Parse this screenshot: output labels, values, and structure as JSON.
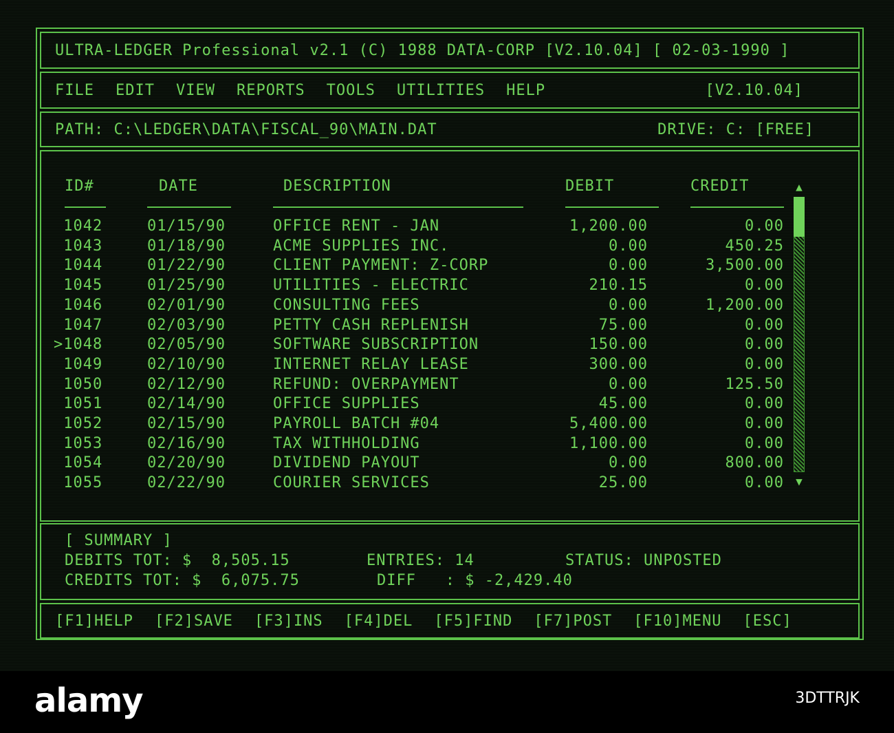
{
  "app": {
    "title": "ULTRA-LEDGER Professional v2.1 (C) 1988 DATA-CORP [V2.10.04] [ 02-03-1990 ]"
  },
  "menu": {
    "items": [
      "FILE",
      "EDIT",
      "VIEW",
      "REPORTS",
      "TOOLS",
      "UTILITIES",
      "HELP"
    ],
    "version": "[V2.10.04]"
  },
  "path_bar": {
    "path": "PATH: C:\\LEDGER\\DATA\\FISCAL_90\\MAIN.DAT",
    "drive": "DRIVE: C: [FREE]"
  },
  "table": {
    "headers": {
      "id": "ID#",
      "date": "DATE",
      "description": "DESCRIPTION",
      "debit": "DEBIT",
      "credit": "CREDIT"
    },
    "rows": [
      {
        "id": " 1042",
        "date": "01/15/90",
        "description": "OFFICE RENT - JAN",
        "debit": "1,200.00",
        "credit": "0.00"
      },
      {
        "id": " 1043",
        "date": "01/18/90",
        "description": "ACME SUPPLIES INC.",
        "debit": "0.00",
        "credit": "450.25"
      },
      {
        "id": " 1044",
        "date": "01/22/90",
        "description": "CLIENT PAYMENT: Z-CORP",
        "debit": "0.00",
        "credit": "3,500.00"
      },
      {
        "id": " 1045",
        "date": "01/25/90",
        "description": "UTILITIES - ELECTRIC",
        "debit": "210.15",
        "credit": "0.00"
      },
      {
        "id": " 1046",
        "date": "02/01/90",
        "description": "CONSULTING FEES",
        "debit": "0.00",
        "credit": "1,200.00"
      },
      {
        "id": " 1047",
        "date": "02/03/90",
        "description": "PETTY CASH REPLENISH",
        "debit": "75.00",
        "credit": "0.00"
      },
      {
        "id": ">1048",
        "date": "02/05/90",
        "description": "SOFTWARE SUBSCRIPTION",
        "debit": "150.00",
        "credit": "0.00"
      },
      {
        "id": " 1049",
        "date": "02/10/90",
        "description": "INTERNET RELAY LEASE",
        "debit": "300.00",
        "credit": "0.00"
      },
      {
        "id": " 1050",
        "date": "02/12/90",
        "description": "REFUND: OVERPAYMENT",
        "debit": "0.00",
        "credit": "125.50"
      },
      {
        "id": " 1051",
        "date": "02/14/90",
        "description": "OFFICE SUPPLIES",
        "debit": "45.00",
        "credit": "0.00"
      },
      {
        "id": " 1052",
        "date": "02/15/90",
        "description": "PAYROLL BATCH #04",
        "debit": "5,400.00",
        "credit": "0.00"
      },
      {
        "id": " 1053",
        "date": "02/16/90",
        "description": "TAX WITHHOLDING",
        "debit": "1,100.00",
        "credit": "0.00"
      },
      {
        "id": " 1054",
        "date": "02/20/90",
        "description": "DIVIDEND PAYOUT",
        "debit": "0.00",
        "credit": "800.00"
      },
      {
        "id": " 1055",
        "date": "02/22/90",
        "description": "COURIER SERVICES",
        "debit": "25.00",
        "credit": "0.00"
      }
    ]
  },
  "scrollbar": {
    "up_arrow": "▲",
    "down_arrow": "▼"
  },
  "summary": {
    "heading": "[ SUMMARY ]",
    "debits_label": "DEBITS TOT: $  8,505.15",
    "credits_label": "CREDITS TOT: $  6,075.75",
    "entries_label": "ENTRIES: 14",
    "diff_label": "DIFF   : $ -2,429.40",
    "status_label": "STATUS: UNPOSTED"
  },
  "function_keys": [
    "[F1]HELP",
    "[F2]SAVE",
    "[F3]INS",
    "[F4]DEL",
    "[F5]FIND",
    "[F7]POST",
    "[F10]MENU",
    "[ESC]"
  ],
  "footer": {
    "logo": "alamy",
    "image_id": "3DTTRJK"
  },
  "colors": {
    "phosphor": "#6fd35a",
    "border": "#5cc24a",
    "background": "#0b120b"
  }
}
